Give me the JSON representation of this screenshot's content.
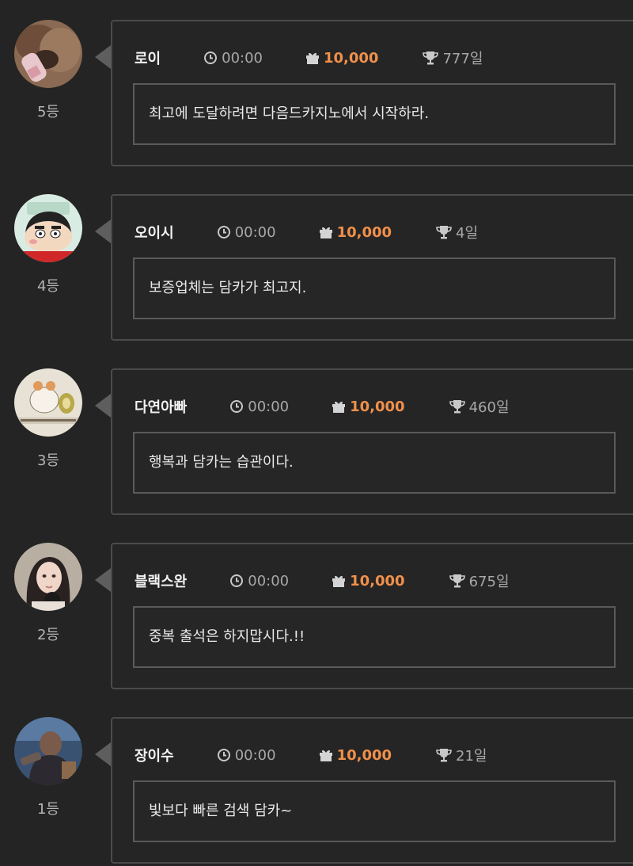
{
  "entries": [
    {
      "rank": "5등",
      "nickname": "로이",
      "time": "00:00",
      "reward": "10,000",
      "streak": "777일",
      "message": "최고에 도달하려면 다음드카지노에서 시작하라."
    },
    {
      "rank": "4등",
      "nickname": "오이시",
      "time": "00:00",
      "reward": "10,000",
      "streak": "4일",
      "message": "보증업체는 담카가 최고지."
    },
    {
      "rank": "3등",
      "nickname": "다연아빠",
      "time": "00:00",
      "reward": "10,000",
      "streak": "460일",
      "message": "행복과 담카는 습관이다."
    },
    {
      "rank": "2등",
      "nickname": "블랙스완",
      "time": "00:00",
      "reward": "10,000",
      "streak": "675일",
      "message": "중복 출석은 하지맙시다.!!"
    },
    {
      "rank": "1등",
      "nickname": "장이수",
      "time": "00:00",
      "reward": "10,000",
      "streak": "21일",
      "message": "빛보다 빠른 검색 담카~"
    }
  ],
  "icons": {
    "time": "clock-icon",
    "reward": "gift-icon",
    "streak": "trophy-icon"
  },
  "colors": {
    "background": "#242424",
    "reward_accent": "#f0904a",
    "border": "#4b4b4b"
  }
}
